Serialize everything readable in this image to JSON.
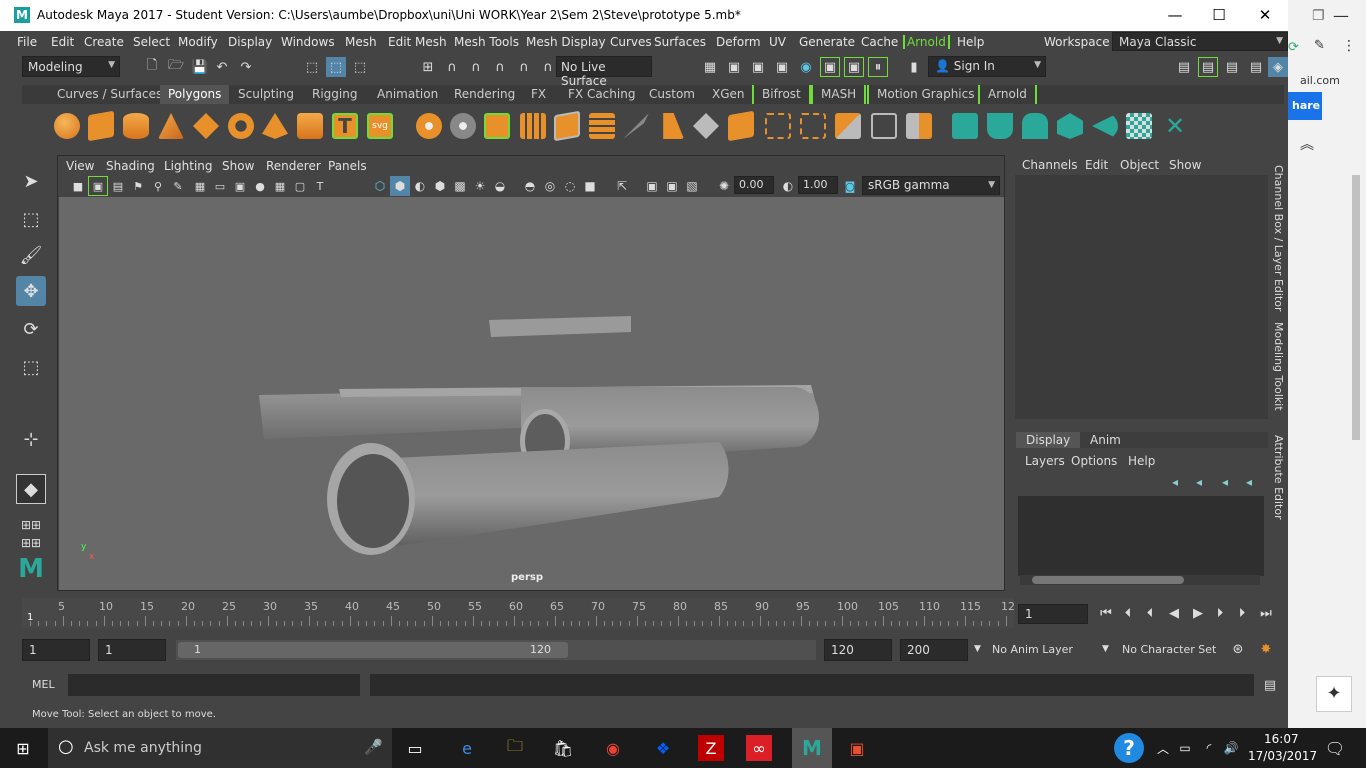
{
  "window": {
    "title": "Autodesk Maya 2017 - Student Version: C:\\Users\\aumbe\\Dropbox\\uni\\Uni WORK\\Year 2\\Sem 2\\Steve\\prototype 5.mb*",
    "logo_letter": "M"
  },
  "menus": [
    "File",
    "Edit",
    "Create",
    "Select",
    "Modify",
    "Display",
    "Windows",
    "Mesh",
    "Edit Mesh",
    "Mesh Tools",
    "Mesh Display",
    "Curves",
    "Surfaces",
    "Deform",
    "UV",
    "Generate",
    "Cache",
    "Arnold",
    "Help"
  ],
  "workspace": {
    "label": "Workspace :",
    "value": "Maya Classic"
  },
  "status_line": {
    "menu_set": "Modeling",
    "live_surface": "No Live Surface",
    "sign_in": "Sign In"
  },
  "shelf_tabs": [
    "Curves / Surfaces",
    "Polygons",
    "Sculpting",
    "Rigging",
    "Animation",
    "Rendering",
    "FX",
    "FX Caching",
    "Custom",
    "XGen",
    "Bifrost",
    "MASH",
    "Motion Graphics",
    "Arnold"
  ],
  "shelf_active": "Polygons",
  "viewport": {
    "menus": [
      "View",
      "Shading",
      "Lighting",
      "Show",
      "Renderer",
      "Panels"
    ],
    "exposure": "0.00",
    "gamma": "1.00",
    "color_space": "sRGB gamma",
    "camera_label": "persp"
  },
  "channel_box": {
    "menus": [
      "Channels",
      "Edit",
      "Object",
      "Show"
    ],
    "layer_tabs": [
      "Display",
      "Anim"
    ],
    "layer_menus": [
      "Layers",
      "Options",
      "Help"
    ],
    "side_tabs": [
      "Channel Box / Layer Editor",
      "Modeling Toolkit",
      "Attribute Editor"
    ]
  },
  "timeline": {
    "ticks": [
      "5",
      "10",
      "15",
      "20",
      "25",
      "30",
      "35",
      "40",
      "45",
      "50",
      "55",
      "60",
      "65",
      "70",
      "75",
      "80",
      "85",
      "90",
      "95",
      "100",
      "105",
      "110",
      "115",
      "12"
    ],
    "current_frame_marker": "1",
    "current_frame": "1"
  },
  "range": {
    "start": "1",
    "playback_start": "1",
    "slider_start": "1",
    "slider_end": "120",
    "playback_end": "120",
    "end": "200",
    "anim_layer": "No Anim Layer",
    "character_set": "No Character Set"
  },
  "command_line": {
    "label": "MEL"
  },
  "help_line": "Move Tool: Select an object to move.",
  "browser_peek": {
    "text": "ail.com",
    "button": "hare"
  },
  "taskbar": {
    "search": "Ask me anything",
    "time": "16:07",
    "date": "17/03/2017"
  },
  "colors": {
    "accent_blue": "#5285a6",
    "highlight_green": "#6fdc3a",
    "shelf_teal": "#2aa89a",
    "orange": "#e8912b"
  }
}
